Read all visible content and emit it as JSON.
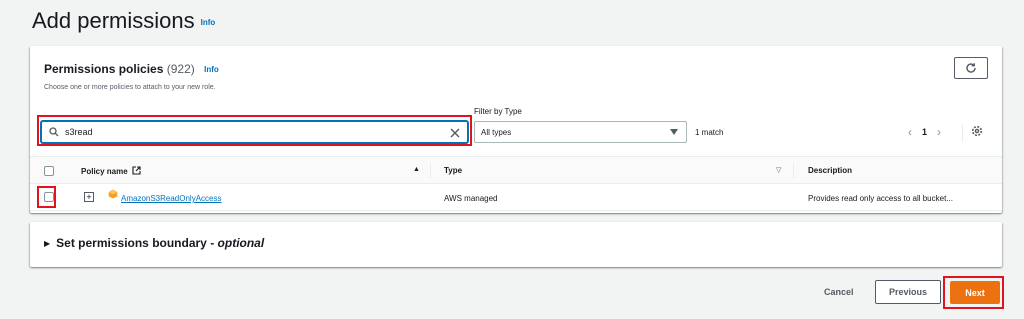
{
  "page": {
    "title": "Add permissions",
    "info": "Info"
  },
  "policies": {
    "title": "Permissions policies",
    "count": "(922)",
    "info": "Info",
    "description": "Choose one or more policies to attach to your new role.",
    "search_value": "s3read",
    "filter_label": "Filter by Type",
    "filter_value": "All types",
    "match_text": "1 match",
    "page_number": "1",
    "columns": {
      "name": "Policy name",
      "type": "Type",
      "description": "Description"
    },
    "rows": [
      {
        "name": "AmazonS3ReadOnlyAccess",
        "type": "AWS managed",
        "description": "Provides read only access to all bucket..."
      }
    ]
  },
  "boundary": {
    "title": "Set permissions boundary - ",
    "optional": "optional"
  },
  "footer": {
    "cancel": "Cancel",
    "previous": "Previous",
    "next": "Next"
  },
  "colors": {
    "accent": "#0073bb",
    "primary_button": "#ec7211",
    "highlight": "#e0141e"
  }
}
